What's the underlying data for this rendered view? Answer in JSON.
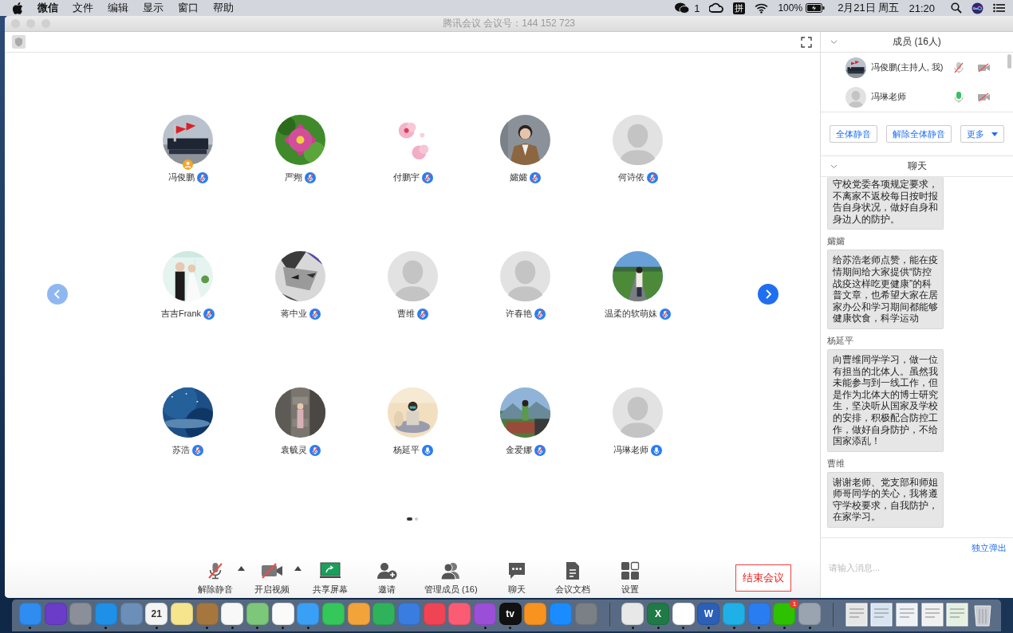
{
  "menu_bar": {
    "app_menus": [
      "微信",
      "文件",
      "编辑",
      "显示",
      "窗口",
      "帮助"
    ],
    "wechat_count": "1",
    "input_method": "拼",
    "battery": "100%",
    "date": "2月21日 周五",
    "time": "21:20"
  },
  "window": {
    "title": "腾讯会议 会议号：144 152 723"
  },
  "participants": [
    {
      "name": "冯俊鹏",
      "kind": "picture",
      "muted": true,
      "host": true
    },
    {
      "name": "严翙",
      "kind": "picture",
      "muted": true,
      "host": false
    },
    {
      "name": "付鹏宇",
      "kind": "picture",
      "muted": true,
      "host": false
    },
    {
      "name": "孀孀",
      "kind": "picture",
      "muted": true,
      "host": false
    },
    {
      "name": "何诗依",
      "kind": "default",
      "muted": true,
      "host": false
    },
    {
      "name": "吉吉Frank",
      "kind": "picture",
      "muted": true,
      "host": false
    },
    {
      "name": "蒋中业",
      "kind": "picture",
      "muted": true,
      "host": false
    },
    {
      "name": "曹维",
      "kind": "default",
      "muted": true,
      "host": false
    },
    {
      "name": "许春艳",
      "kind": "default",
      "muted": true,
      "host": false
    },
    {
      "name": "温柔的软萌妹",
      "kind": "picture",
      "muted": true,
      "host": false
    },
    {
      "name": "苏浩",
      "kind": "picture",
      "muted": true,
      "host": false
    },
    {
      "name": "袁毓灵",
      "kind": "picture",
      "muted": true,
      "host": false
    },
    {
      "name": "杨延平",
      "kind": "picture",
      "muted": false,
      "host": false
    },
    {
      "name": "金爱娜",
      "kind": "picture",
      "muted": true,
      "host": false
    },
    {
      "name": "冯琳老师",
      "kind": "default",
      "muted": false,
      "host": false
    }
  ],
  "nav": {
    "previous_disabled": true,
    "next_disabled": false
  },
  "pages": [
    {
      "selected": true
    },
    {
      "selected": false
    }
  ],
  "toolbar": [
    {
      "kind": "mic",
      "label": "解除静音",
      "off": true,
      "has_menu": true
    },
    {
      "kind": "video",
      "label": "开启视频",
      "off": true,
      "has_menu": true
    },
    {
      "kind": "share",
      "label": "共享屏幕",
      "has_menu": false
    },
    {
      "kind": "invite",
      "label": "邀请",
      "has_menu": false
    },
    {
      "kind": "members",
      "label": "管理成员 (16)",
      "has_menu": false
    },
    {
      "kind": "chat",
      "label": "聊天",
      "has_menu": false
    },
    {
      "kind": "docs",
      "label": "会议文档",
      "has_menu": false
    },
    {
      "kind": "settings",
      "label": "设置",
      "has_menu": false
    }
  ],
  "end_button": "结束会议",
  "members_panel": {
    "title": "成员 (16人)",
    "members": [
      {
        "name": "冯俊鹏(主持人, 我)",
        "kind": "picture",
        "muted": true,
        "video_off": true
      },
      {
        "name": "冯琳老师",
        "kind": "default",
        "muted": false,
        "video_off": true
      }
    ],
    "buttons": [
      "全体静音",
      "解除全体静音",
      "更多"
    ]
  },
  "chat_panel": {
    "title": "聊天",
    "messages": [
      {
        "text": "守校党委各项规定要求，不离家不返校每日按时报告自身状况，做好自身和身边人的防护。"
      },
      {
        "sender": "孀孀",
        "text": "给苏浩老师点赞，能在疫情期间给大家提供“防控战疫这样吃更健康”的科普文章，也希望大家在居家办公和学习期间都能够健康饮食，科学运动"
      },
      {
        "sender": "杨延平",
        "text": "向曹维同学学习，做一位有担当的北体人。虽然我未能参与到一线工作，但是作为北体大的博士研究生，坚决听从国家及学校的安排，积极配合防控工作，做好自身防护，不给国家添乱！"
      },
      {
        "sender": "曹维",
        "text": "谢谢老师、党支部和师姐师哥同学的关心，我将遵守学校要求，自我防护，在家学习。"
      }
    ],
    "popout_link": "独立弹出",
    "input": {
      "placeholder": "请输入消息..."
    }
  },
  "dock": [
    {
      "kind": "app",
      "color": "#2f8cf0",
      "running": true
    },
    {
      "kind": "app",
      "color": "#6a3cc8",
      "running": false
    },
    {
      "kind": "app",
      "color": "#8a8f99",
      "running": false
    },
    {
      "kind": "app",
      "color": "#1e90e8",
      "running": true
    },
    {
      "kind": "app",
      "color": "#6b8fb8",
      "running": false
    },
    {
      "kind": "app",
      "color": "#f4f4f4",
      "label": "21",
      "running": true
    },
    {
      "kind": "app",
      "color": "#f6e58d",
      "running": false
    },
    {
      "kind": "app",
      "color": "#a5773f",
      "running": true
    },
    {
      "kind": "app",
      "color": "#f8f8f8",
      "running": true
    },
    {
      "kind": "app",
      "color": "#7cc77a",
      "running": true
    },
    {
      "kind": "app",
      "color": "#fafafa",
      "running": true
    },
    {
      "kind": "app",
      "color": "#3aa0f5",
      "running": true
    },
    {
      "kind": "app",
      "color": "#34c759",
      "running": false
    },
    {
      "kind": "app",
      "color": "#f2a33a",
      "running": false
    },
    {
      "kind": "app",
      "color": "#2fb35a",
      "running": false
    },
    {
      "kind": "app",
      "color": "#3a7de0",
      "running": false
    },
    {
      "kind": "app",
      "color": "#f04455",
      "running": false
    },
    {
      "kind": "app",
      "color": "#fb5c74",
      "running": false
    },
    {
      "kind": "app",
      "color": "#9b4fd8",
      "running": true
    },
    {
      "kind": "app",
      "color": "#111111",
      "label": "tv",
      "running": true
    },
    {
      "kind": "app",
      "color": "#f7931e",
      "running": false
    },
    {
      "kind": "app",
      "color": "#1a8cff",
      "running": false
    },
    {
      "kind": "app",
      "color": "#7b7f86",
      "running": false
    },
    {
      "kind": "separator"
    },
    {
      "kind": "app",
      "color": "#e8e8e8",
      "running": true
    },
    {
      "kind": "app",
      "color": "#1f7a45",
      "label": "X",
      "running": true
    },
    {
      "kind": "app",
      "color": "#ffffff",
      "running": true
    },
    {
      "kind": "app",
      "color": "#2b5fb8",
      "label": "W",
      "running": true
    },
    {
      "kind": "app",
      "color": "#1fb0e8",
      "running": true
    },
    {
      "kind": "app",
      "color": "#2a7df0",
      "running": true
    },
    {
      "kind": "app",
      "color": "#2dc100",
      "badge": "1",
      "running": true
    },
    {
      "kind": "app",
      "color": "#9aa4b0",
      "running": true
    },
    {
      "kind": "separator"
    },
    {
      "kind": "doc",
      "color": "#e6e6e6",
      "running": false
    },
    {
      "kind": "doc",
      "color": "#d8e4f0",
      "running": false
    },
    {
      "kind": "doc",
      "color": "#eef2f6",
      "running": false
    },
    {
      "kind": "doc",
      "color": "#f0f0f0",
      "running": false
    },
    {
      "kind": "doc",
      "color": "#e4f0e0",
      "running": false
    },
    {
      "kind": "trash",
      "color": "#c8ccd2",
      "running": false
    }
  ]
}
